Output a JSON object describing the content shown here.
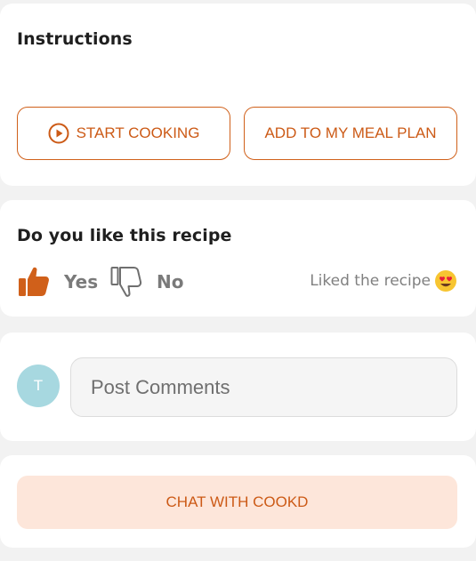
{
  "instructions": {
    "title": "Instructions",
    "start_cooking_label": "START COOKING",
    "start_cooking_icon": "play-circle-icon",
    "meal_plan_label": "ADD TO MY MEAL PLAN"
  },
  "feedback": {
    "title": "Do you like this recipe",
    "yes_label": "Yes",
    "yes_icon": "thumbs-up-icon",
    "no_label": "No",
    "no_icon": "thumbs-down-icon",
    "status_text": "Liked the recipe",
    "status_icon": "heart-eyes-emoji-icon"
  },
  "comments": {
    "avatar_initial": "T",
    "placeholder": "Post Comments",
    "value": ""
  },
  "chat": {
    "label": "CHAT WITH COOKD"
  },
  "colors": {
    "accent": "#cc5a16",
    "thumb_active": "#d0601a",
    "avatar_bg": "#a7d8e0",
    "chat_button_bg": "#fde6da",
    "page_bg": "#f2f2f2"
  }
}
